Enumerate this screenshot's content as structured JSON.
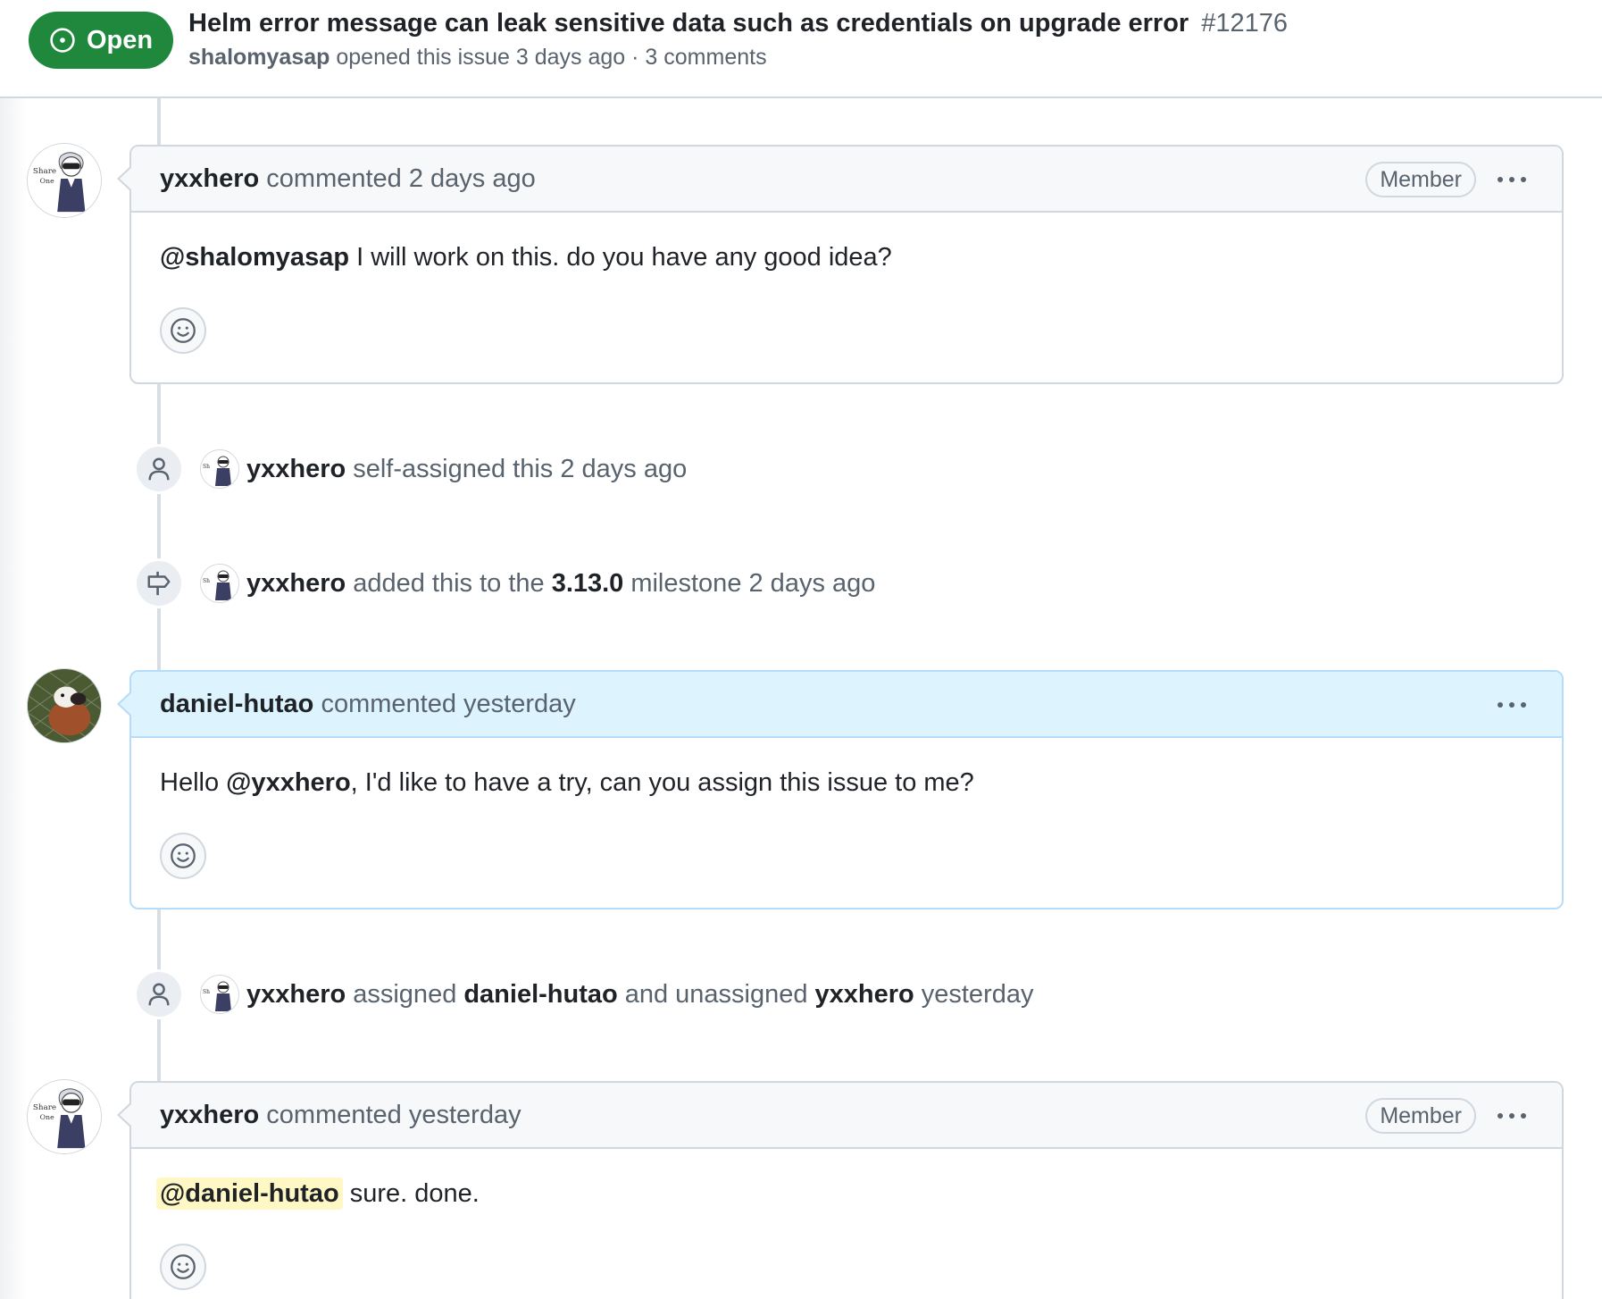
{
  "header": {
    "state_label": "Open",
    "title": "Helm error message can leak sensitive data such as credentials on upgrade error",
    "number": "#12176",
    "author": "shalomyasap",
    "meta_text": "opened this issue 3 days ago · 3 comments"
  },
  "timeline": {
    "comment1": {
      "author": "yxxhero",
      "action": "commented 2 days ago",
      "role": "Member",
      "mention": "@shalomyasap",
      "body": "I will work on this. do you have any good idea?"
    },
    "event1": {
      "actor": "yxxhero",
      "text": "self-assigned this 2 days ago"
    },
    "event2": {
      "actor": "yxxhero",
      "text_before": "added this to the",
      "milestone": "3.13.0",
      "text_after": "milestone 2 days ago"
    },
    "comment2": {
      "author": "daniel-hutao",
      "action": "commented yesterday",
      "body_before": "Hello",
      "mention": "@yxxhero",
      "body_after": ", I'd like to have a try, can you assign this issue to me?"
    },
    "event3": {
      "actor": "yxxhero",
      "text_assigned": "assigned",
      "assignee": "daniel-hutao",
      "text_and": "and unassigned",
      "unassignee": "yxxhero",
      "time": "yesterday"
    },
    "comment3": {
      "author": "yxxhero",
      "action": "commented yesterday",
      "role": "Member",
      "mention": "@daniel-hutao",
      "body": "sure. done."
    }
  },
  "colors": {
    "open_green": "#1f883d",
    "highlight_blue": "#ddf4ff",
    "mention_yellow": "#fff8c5"
  },
  "icons": {
    "state": "issue-opened-icon",
    "person": "person-icon",
    "milestone": "milestone-icon",
    "reaction": "smiley-icon",
    "more": "kebab-horizontal-icon"
  }
}
